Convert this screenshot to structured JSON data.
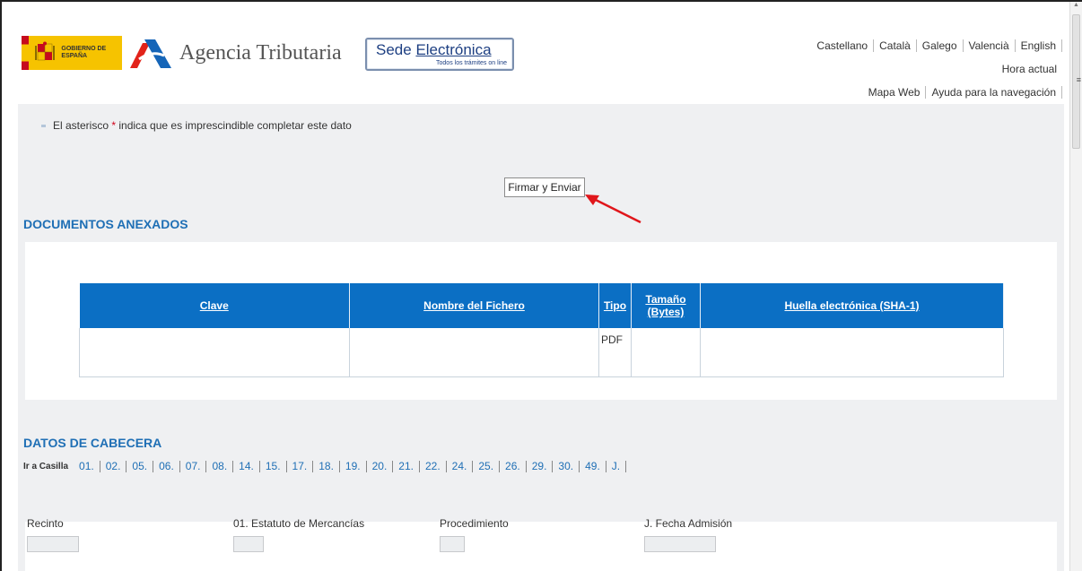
{
  "header": {
    "gov_logo_text": "GOBIERNO DE ESPAÑA",
    "agency_name": "Agencia Tributaria",
    "sede_title_part1": "Sede ",
    "sede_title_part2": "Electrónica",
    "sede_subtitle": "Todos los trámites on line",
    "languages": [
      "Castellano",
      "Català",
      "Galego",
      "Valencià",
      "English"
    ],
    "hora_actual": "Hora actual",
    "nav_links": [
      "Mapa Web",
      "Ayuda para la navegación"
    ]
  },
  "note": {
    "prefix": "El asterisco ",
    "asterisk": "*",
    "suffix": " indica que es imprescindible completar este dato"
  },
  "sign_button_label": "Firmar y Enviar",
  "docs_section": {
    "title": "DOCUMENTOS ANEXADOS",
    "columns": [
      "Clave",
      "Nombre del Fichero",
      "Tipo",
      "Tamaño (Bytes)",
      "Huella electrónica (SHA-1)"
    ],
    "rows": [
      {
        "clave": "",
        "nombre": "",
        "tipo": "PDF",
        "tamano": "",
        "huella": ""
      }
    ]
  },
  "cabecera_section": {
    "title": "DATOS DE CABECERA",
    "ir_a_casilla_label": "Ir a Casilla",
    "casillas": [
      "01.",
      "02.",
      "05.",
      "06.",
      "07.",
      "08.",
      "14.",
      "15.",
      "17.",
      "18.",
      "19.",
      "20.",
      "21.",
      "22.",
      "24.",
      "25.",
      "26.",
      "29.",
      "30.",
      "49.",
      "J."
    ],
    "fields": [
      {
        "label": "Recinto",
        "value": ""
      },
      {
        "label": "01. Estatuto de Mercancías",
        "value": ""
      },
      {
        "label": "Procedimiento",
        "value": ""
      },
      {
        "label": "J. Fecha Admisión",
        "value": ""
      }
    ]
  },
  "colors": {
    "accent_blue": "#1f6fb5",
    "table_header": "#0b6fc4",
    "required_red": "#d0021b",
    "annotation_arrow": "#e0161b"
  }
}
